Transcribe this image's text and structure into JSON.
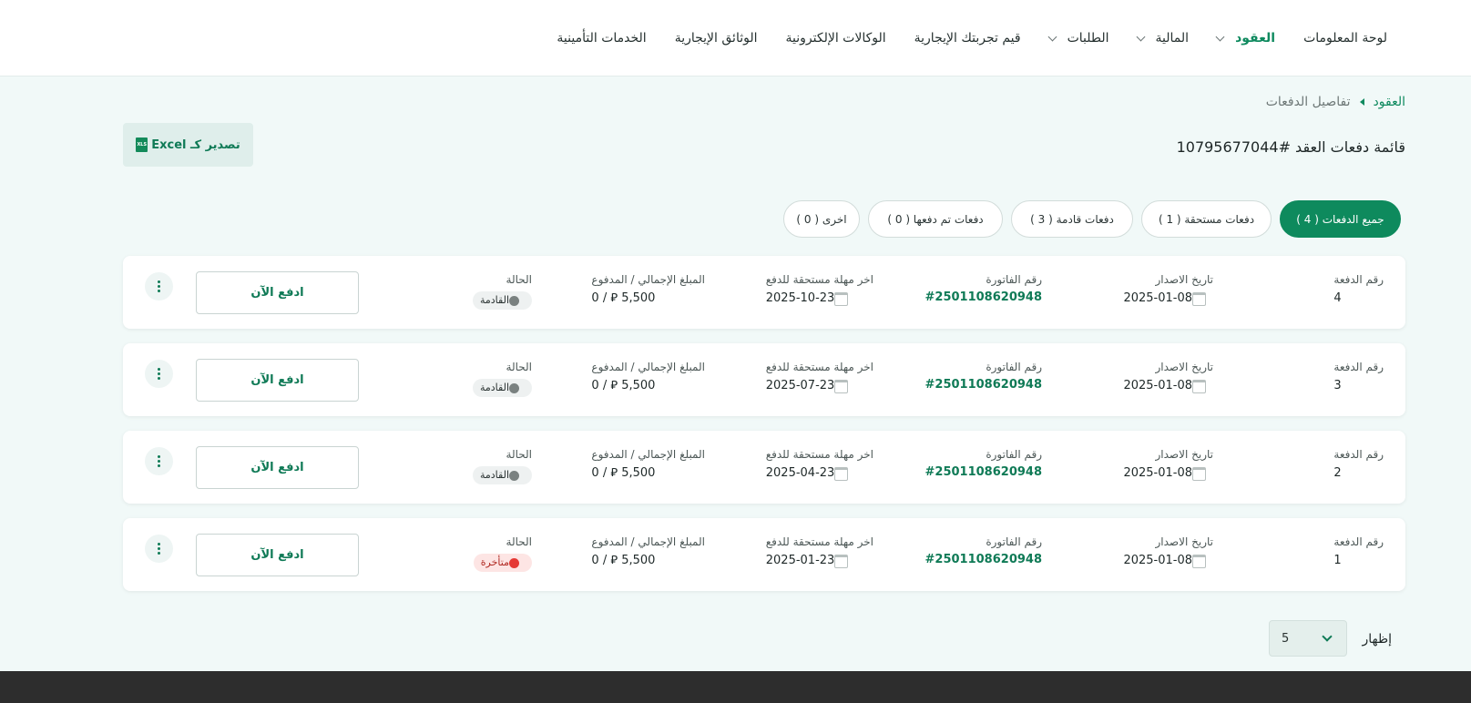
{
  "nav": {
    "items": [
      {
        "label": "لوحة المعلومات",
        "active": false,
        "dropdown": false
      },
      {
        "label": "العقود",
        "active": true,
        "dropdown": true
      },
      {
        "label": "المالية",
        "active": false,
        "dropdown": true
      },
      {
        "label": "الطلبات",
        "active": false,
        "dropdown": true
      },
      {
        "label": "قيم تجربتك الإيجارية",
        "active": false,
        "dropdown": false
      },
      {
        "label": "الوكالات الإلكترونية",
        "active": false,
        "dropdown": false
      },
      {
        "label": "الوثائق الإيجارية",
        "active": false,
        "dropdown": false
      },
      {
        "label": "الخدمات التأمينية",
        "active": false,
        "dropdown": false
      }
    ]
  },
  "breadcrumb": {
    "root": "العقود",
    "current": "تفاصيل الدفعات"
  },
  "page_title": "قائمة دفعات العقد #10795677044",
  "export": {
    "label": "تصدير كـ Excel",
    "icon": "excel-file-icon",
    "icon_text": "XLS"
  },
  "filters": [
    {
      "label": "جميع الدفعات ( 4 )",
      "active": true
    },
    {
      "label": "دفعات مستحقة ( 1 )",
      "active": false
    },
    {
      "label": "دفعات قادمة ( 3 )",
      "active": false
    },
    {
      "label": "دفعات تم دفعها ( 0 )",
      "active": false
    },
    {
      "label": "اخرى ( 0 )",
      "active": false
    }
  ],
  "columns": {
    "number": "رقم الدفعة",
    "issue_date": "تاريخ الاصدار",
    "invoice": "رقم الفاتورة",
    "due_date": "اخر مهلة مستحقة للدفع",
    "amount": "المبلغ الإجمالي / المدفوع",
    "status": "الحالة"
  },
  "payments": [
    {
      "number": "4",
      "issue_date": "2025-01-08",
      "invoice": "#250110862094​8",
      "due_date": "2025-10-23",
      "amount": "5,500 ⃁ / 0",
      "status": "القادمة",
      "status_type": "upcoming",
      "pay_label": "ادفع الآن"
    },
    {
      "number": "3",
      "issue_date": "2025-01-08",
      "invoice": "#2501108620948",
      "due_date": "2025-07-23",
      "amount": "5,500 ⃁ / 0",
      "status": "القادمة",
      "status_type": "upcoming",
      "pay_label": "ادفع الآن"
    },
    {
      "number": "2",
      "issue_date": "2025-01-08",
      "invoice": "#2501108620948",
      "due_date": "2025-04-23",
      "amount": "5,500 ⃁ / 0",
      "status": "القادمة",
      "status_type": "upcoming",
      "pay_label": "ادفع الآن"
    },
    {
      "number": "1",
      "issue_date": "2025-01-08",
      "invoice": "#2501108620948",
      "due_date": "2025-01-23",
      "amount": "5,500 ⃁ / 0",
      "status": "متأخرة",
      "status_type": "late",
      "pay_label": "ادفع الآن"
    }
  ],
  "pagination": {
    "show_label": "إظهار",
    "page_size": "5"
  },
  "colors": {
    "brand": "#0e8a5d",
    "late": "#e53935",
    "upcoming": "#7a8180"
  }
}
